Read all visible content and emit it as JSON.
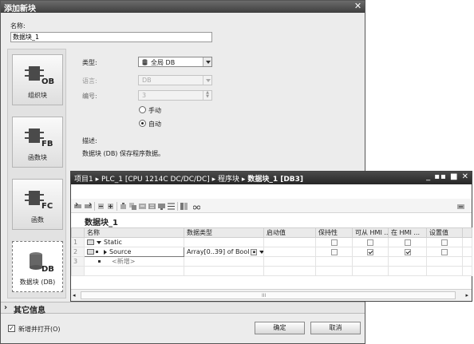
{
  "dialog": {
    "title": "添加新块",
    "close_glyph": "✕",
    "name_label": "名称:",
    "name_value": "数据块_1",
    "block_types": [
      {
        "code": "OB",
        "label": "组织块"
      },
      {
        "code": "FB",
        "label": "函数块"
      },
      {
        "code": "FC",
        "label": "函数"
      },
      {
        "code": "DB",
        "label": "数据块 (DB)"
      }
    ],
    "type_label": "类型:",
    "type_value": "全局 DB",
    "language_label": "语言:",
    "language_value": "DB",
    "number_label": "编号:",
    "number_value": "3",
    "manual_label": "手动",
    "auto_label": "自动",
    "description_label": "描述:",
    "description_text": "数据块 (DB) 保存程序数据。",
    "more_info_label": "其它信息",
    "add_and_open_label": "新增并打开(O)",
    "ok_label": "确定",
    "cancel_label": "取消"
  },
  "editor": {
    "breadcrumb": [
      "项目1",
      "PLC_1 [CPU 1214C DC/DC/DC]",
      "程序块",
      "数据块_1 [DB3]"
    ],
    "window_controls": "_ ▪▪ ■ ✕",
    "block_title": "数据块_1",
    "columns": [
      "名称",
      "数据类型",
      "启动值",
      "保持性",
      "可从 HMI ...",
      "在 HMI ...",
      "设置值"
    ],
    "rows": [
      {
        "num": "1",
        "name": "Static",
        "type": "",
        "start": "",
        "retain": false,
        "hmi_access": false,
        "hmi_visible": false,
        "setpoint": false
      },
      {
        "num": "2",
        "name": "Source",
        "type": "Array[0..39] of Bool",
        "start": "",
        "retain": false,
        "hmi_access": true,
        "hmi_visible": true,
        "setpoint": false
      },
      {
        "num": "3",
        "name": "<新增>",
        "type": "",
        "start": "",
        "retain": null,
        "hmi_access": null,
        "hmi_visible": null,
        "setpoint": null
      }
    ],
    "scroll_grip": "III"
  }
}
